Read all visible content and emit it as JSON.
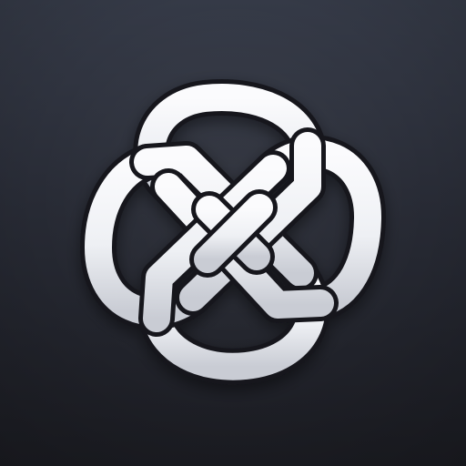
{
  "icon": {
    "name": "celtic-knot-icon",
    "colors": {
      "background_top": "#353a47",
      "background_mid": "#272a34",
      "background_bottom": "#1b1c22",
      "knot_fill": "#f5f6f8",
      "knot_shade": "#c9ccd4",
      "knot_outline": "#15161c"
    }
  }
}
